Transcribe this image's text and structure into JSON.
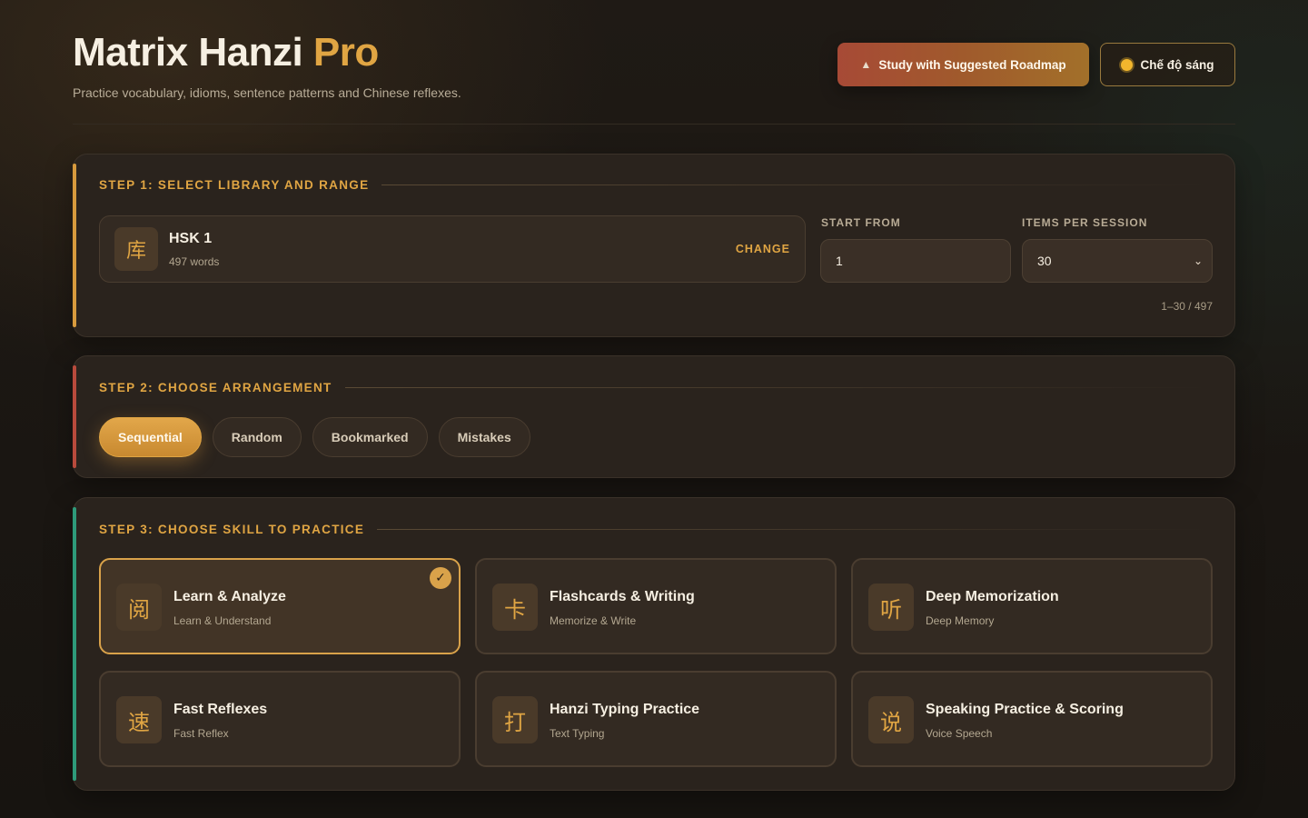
{
  "header": {
    "title_main": "Matrix Hanzi",
    "title_accent": "Pro",
    "subtitle": "Practice vocabulary, idioms, sentence patterns and Chinese reflexes.",
    "roadmap_button": "Study with Suggested Roadmap",
    "theme_button": "Chế độ sáng"
  },
  "step1": {
    "title": "STEP 1: SELECT LIBRARY AND RANGE",
    "library": {
      "icon_char": "库",
      "name": "HSK 1",
      "count": "497 words",
      "change": "CHANGE"
    },
    "start_label": "START FROM",
    "start_value": "1",
    "items_label": "ITEMS PER SESSION",
    "items_value": "30",
    "range_note": "1–30 / 497"
  },
  "step2": {
    "title": "STEP 2: CHOOSE ARRANGEMENT",
    "options": [
      "Sequential",
      "Random",
      "Bookmarked",
      "Mistakes"
    ],
    "selected": "Sequential"
  },
  "step3": {
    "title": "STEP 3: CHOOSE SKILL TO PRACTICE",
    "skills": [
      {
        "icon_char": "阅",
        "name": "Learn & Analyze",
        "sub": "Learn & Understand",
        "selected": true
      },
      {
        "icon_char": "卡",
        "name": "Flashcards & Writing",
        "sub": "Memorize & Write",
        "selected": false
      },
      {
        "icon_char": "听",
        "name": "Deep Memorization",
        "sub": "Deep Memory",
        "selected": false
      },
      {
        "icon_char": "速",
        "name": "Fast Reflexes",
        "sub": "Fast Reflex",
        "selected": false
      },
      {
        "icon_char": "打",
        "name": "Hanzi Typing Practice",
        "sub": "Text Typing",
        "selected": false
      },
      {
        "icon_char": "说",
        "name": "Speaking Practice & Scoring",
        "sub": "Voice Speech",
        "selected": false
      }
    ]
  },
  "colors": {
    "accent": "#e0a543",
    "step1_bar": "#d79a3d",
    "step2_bar": "#b84a3c",
    "step3_bar": "#2e9a7a"
  },
  "icons": {
    "roadmap": "graduation-cap-icon",
    "theme": "sun-icon",
    "select": "chevron-down-icon",
    "selected": "check-icon"
  }
}
